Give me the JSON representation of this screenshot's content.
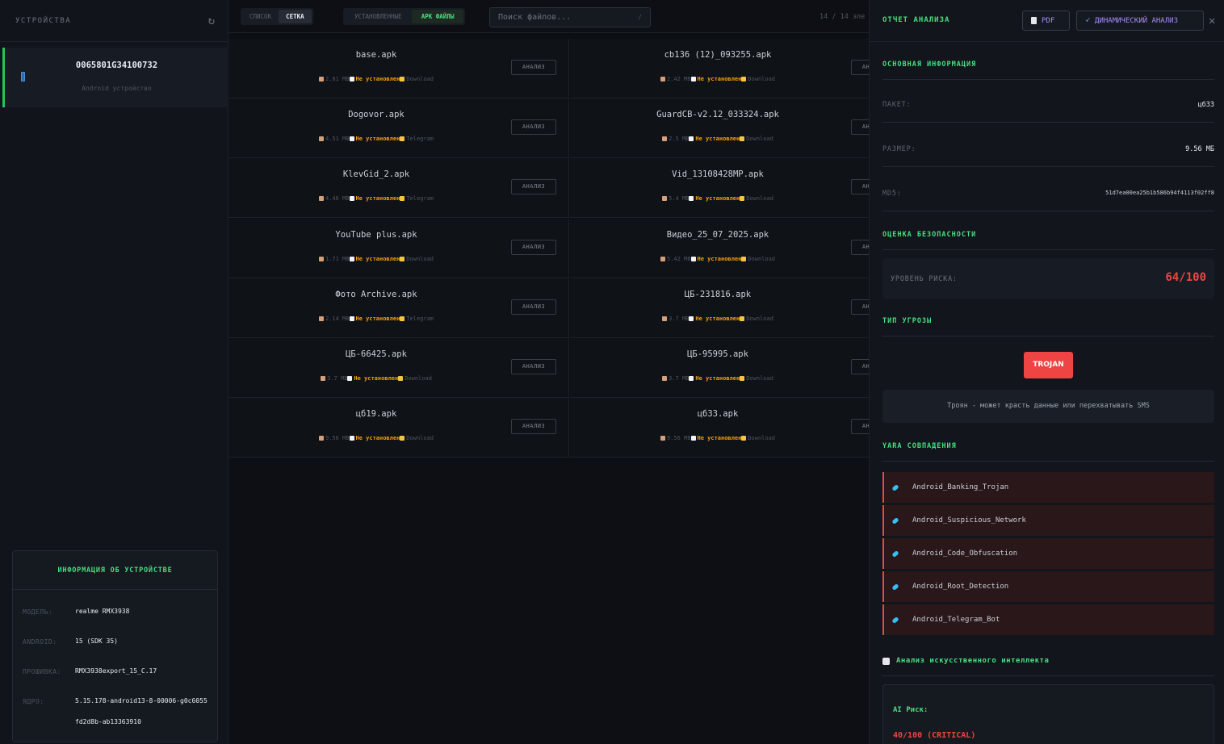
{
  "sidebar": {
    "title": "УСТРОЙСТВА",
    "device": {
      "id": "0065801G34100732",
      "subtitle": "Android устройство"
    },
    "device_info": {
      "title": "ИНФОРМАЦИЯ ОБ УСТРОЙСТВЕ",
      "rows": [
        {
          "key": "МОДЕЛЬ:",
          "value": "realme RMX3938"
        },
        {
          "key": "ANDROID:",
          "value": "15 (SDK 35)"
        },
        {
          "key": "ПРОШИВКА:",
          "value": "RMX3938export_15_C.17"
        },
        {
          "key": "ЯДРО:",
          "value": "5.15.178-android13-8-00006-g0c6055fd2d8b-ab13363910"
        }
      ]
    }
  },
  "toolbar": {
    "view_list": "СПИСОК",
    "view_grid": "СЕТКА",
    "filter_installed": "УСТАНОВЛЕННЫЕ",
    "filter_apk": "APK ФАЙЛЫ",
    "search_placeholder": "Поиск файлов...",
    "search_shortcut": "/",
    "count": "14 / 14 эле"
  },
  "files": [
    {
      "name": "base.apk",
      "size": "2.81 MB",
      "status": "Не установлен",
      "source": "Download"
    },
    {
      "name": "cb136 (12)_093255.apk",
      "size": "2.42 MB",
      "status": "Не установлен",
      "source": "Download"
    },
    {
      "name": "Dogovor.apk",
      "size": "4.51 MB",
      "status": "Не установлен",
      "source": "Telegram"
    },
    {
      "name": "GuardCB-v2.12_033324.apk",
      "size": "2.5 MB",
      "status": "Не установлен",
      "source": "Download"
    },
    {
      "name": "KlevGid_2.apk",
      "size": "4.46 MB",
      "status": "Не установлен",
      "source": "Telegram"
    },
    {
      "name": "Vid_13108428MP.apk",
      "size": "5.4 MB",
      "status": "Не установлен",
      "source": "Download"
    },
    {
      "name": "YouTube plus.apk",
      "size": "1.71 MB",
      "status": "Не установлен",
      "source": "Download"
    },
    {
      "name": "Видео_25_07_2025.apk",
      "size": "5.42 MB",
      "status": "Не установлен",
      "source": "Download"
    },
    {
      "name": "Фото Archive.apk",
      "size": "2.14 MB",
      "status": "Не установлен",
      "source": "Telegram"
    },
    {
      "name": "ЦБ-231816.apk",
      "size": "3.7 MB",
      "status": "Не установлен",
      "source": "Download"
    },
    {
      "name": "ЦБ-66425.apk",
      "size": "3.7 MB",
      "status": "Не установлен",
      "source": "Download"
    },
    {
      "name": "ЦБ-95995.apk",
      "size": "3.7 MB",
      "status": "Не установлен",
      "source": "Download"
    },
    {
      "name": "цб19.apk",
      "size": "9.56 MB",
      "status": "Не установлен",
      "source": "Download"
    },
    {
      "name": "цб33.apk",
      "size": "9.56 MB",
      "status": "Не установлен",
      "source": "Download"
    }
  ],
  "analyze_label": "АНАЛИЗ",
  "report": {
    "title": "ОТЧЕТ АНАЛИЗА",
    "pdf_label": "PDF",
    "dynamic_label": "ДИНАМИЧЕСКИЙ АНАЛИЗ",
    "basic_title": "ОСНОВНАЯ ИНФОРМАЦИЯ",
    "package_key": "ПАКЕТ:",
    "package_value": "цб33",
    "size_key": "РАЗМЕР:",
    "size_value": "9.56 МБ",
    "md5_key": "MD5:",
    "md5_value": "51d7ea00ea25b1b586b94f4113f02ff8",
    "security_title": "ОЦЕНКА БЕЗОПАСНОСТИ",
    "risk_key": "УРОВЕНЬ РИСКА:",
    "risk_value": "64/100",
    "threat_title": "ТИП УГРОЗЫ",
    "threat_badge": "TROJAN",
    "threat_desc": "Троян - может красть данные или перехватывать SMS",
    "yara_title": "YARA СОВПАДЕНИЯ",
    "yara_matches": [
      "Android_Banking_Trojan",
      "Android_Suspicious_Network",
      "Android_Code_Obfuscation",
      "Android_Root_Detection",
      "Android_Telegram_Bot"
    ],
    "ai_title": "Анализ искусственного интеллекта",
    "ai_risk_label": "AI Риск:",
    "ai_risk_value": "40/100 (CRITICAL)"
  },
  "colors": {
    "accent": "#4ade80",
    "danger": "#ef4444",
    "warning": "#f59e0b",
    "purple": "#a78bfa"
  }
}
